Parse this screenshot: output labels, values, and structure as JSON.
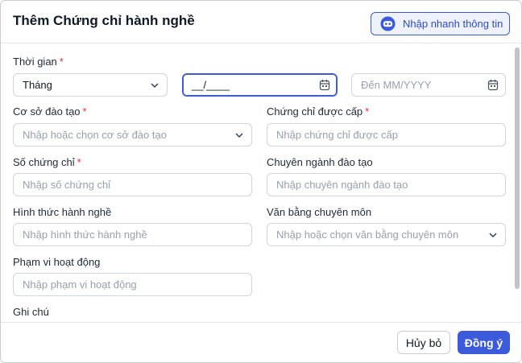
{
  "dialog": {
    "title": "Thêm Chứng chỉ hành nghề",
    "quick_fill_label": "Nhập nhanh thông tin",
    "quick_fill_icon": "robot-icon"
  },
  "form": {
    "time": {
      "label": "Thời gian",
      "required_mark": "*",
      "month_select_value": "Tháng",
      "from_value": "__/____",
      "to_placeholder": "Đến MM/YYYY"
    },
    "training_facility": {
      "label": "Cơ sở đào tạo",
      "required_mark": "*",
      "placeholder": "Nhập hoặc chọn cơ sở đào tạo"
    },
    "certificate_issued": {
      "label": "Chứng chỉ được cấp",
      "required_mark": "*",
      "placeholder": "Nhập chứng chỉ được cấp"
    },
    "certificate_number": {
      "label": "Số chứng chỉ",
      "required_mark": "*",
      "placeholder": "Nhập số chứng chỉ"
    },
    "training_major": {
      "label": "Chuyên ngành đào tạo",
      "placeholder": "Nhập chuyên ngành đào tạo"
    },
    "practice_form": {
      "label": "Hình thức hành nghề",
      "placeholder": "Nhập hình thức hành nghề"
    },
    "professional_degree": {
      "label": "Văn bằng chuyên môn",
      "placeholder": "Nhập hoặc chọn văn bằng chuyên môn"
    },
    "scope": {
      "label": "Phạm vi hoạt động",
      "placeholder": "Nhập phạm vi hoạt động"
    },
    "note": {
      "label": "Ghi chú"
    }
  },
  "footer": {
    "cancel_label": "Hủy bỏ",
    "ok_label": "Đồng ý"
  },
  "colors": {
    "accent": "#3b5bdb",
    "required": "#e03131",
    "border": "#d0d4db"
  }
}
